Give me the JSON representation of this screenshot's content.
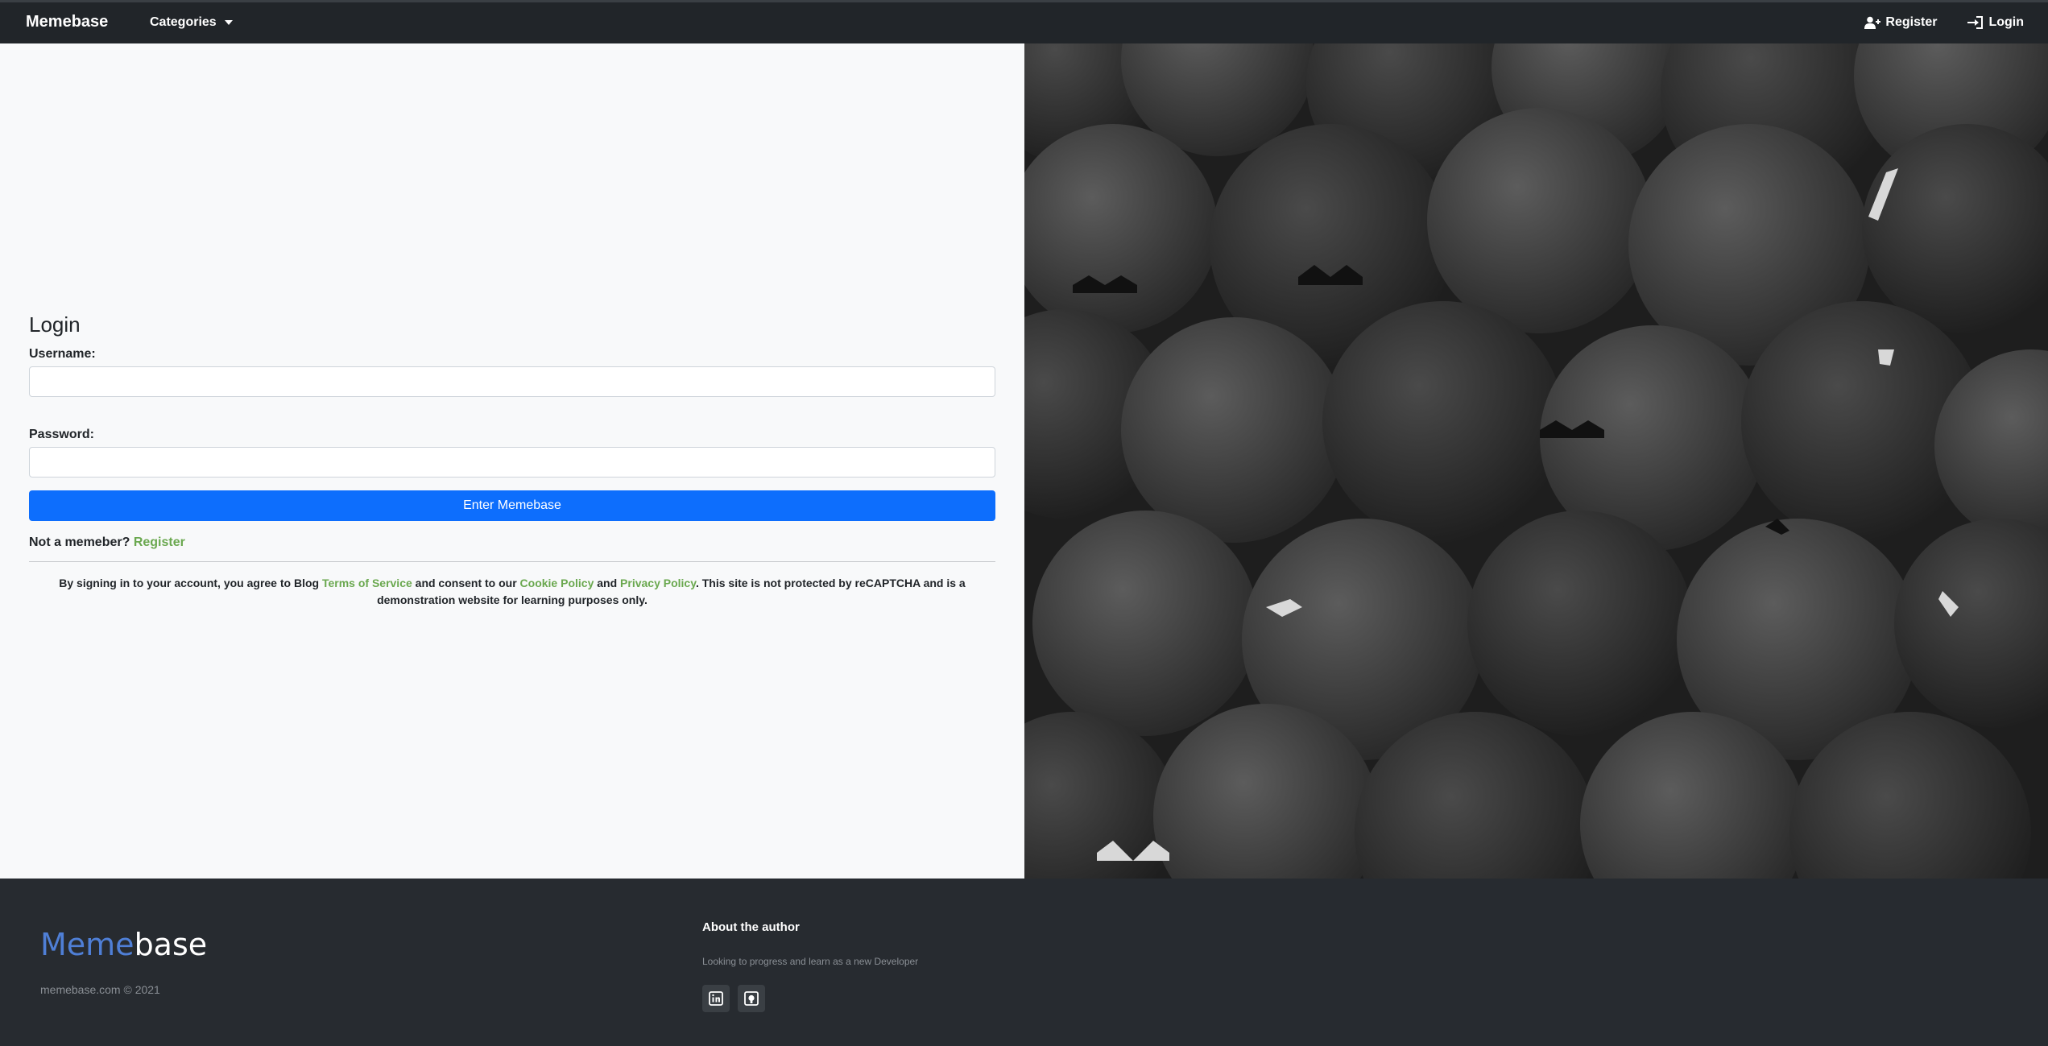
{
  "navbar": {
    "brand": "Memebase",
    "categories_label": "Categories",
    "register_label": "Register",
    "login_label": "Login"
  },
  "login": {
    "title": "Login",
    "username_label": "Username:",
    "username_value": "",
    "password_label": "Password:",
    "password_value": "",
    "submit_label": "Enter Memebase",
    "not_member_text": "Not a memeber?",
    "register_link": "Register",
    "terms": {
      "prefix": "By signing in to your account, you agree to Blog ",
      "tos_link": "Terms of Service",
      "mid1": " and consent to our ",
      "cookie_link": "Cookie Policy",
      "mid2": " and ",
      "privacy_link": "Privacy Policy",
      "suffix": ". This site is not protected by reCAPTCHA and is a demonstration website for learning purposes only."
    }
  },
  "footer": {
    "logo_part1": "Meme",
    "logo_part2": "base",
    "copyright": "memebase.com © 2021",
    "about_title": "About the author",
    "about_text": "Looking to progress and learn as a new Developer",
    "icons": [
      "linkedin-icon",
      "github-icon"
    ]
  },
  "colors": {
    "navbar_bg": "#212529",
    "primary_button": "#0d6efd",
    "link_green": "#6aa84f",
    "footer_bg": "#272b30",
    "logo_blue": "#4f7fd6"
  }
}
